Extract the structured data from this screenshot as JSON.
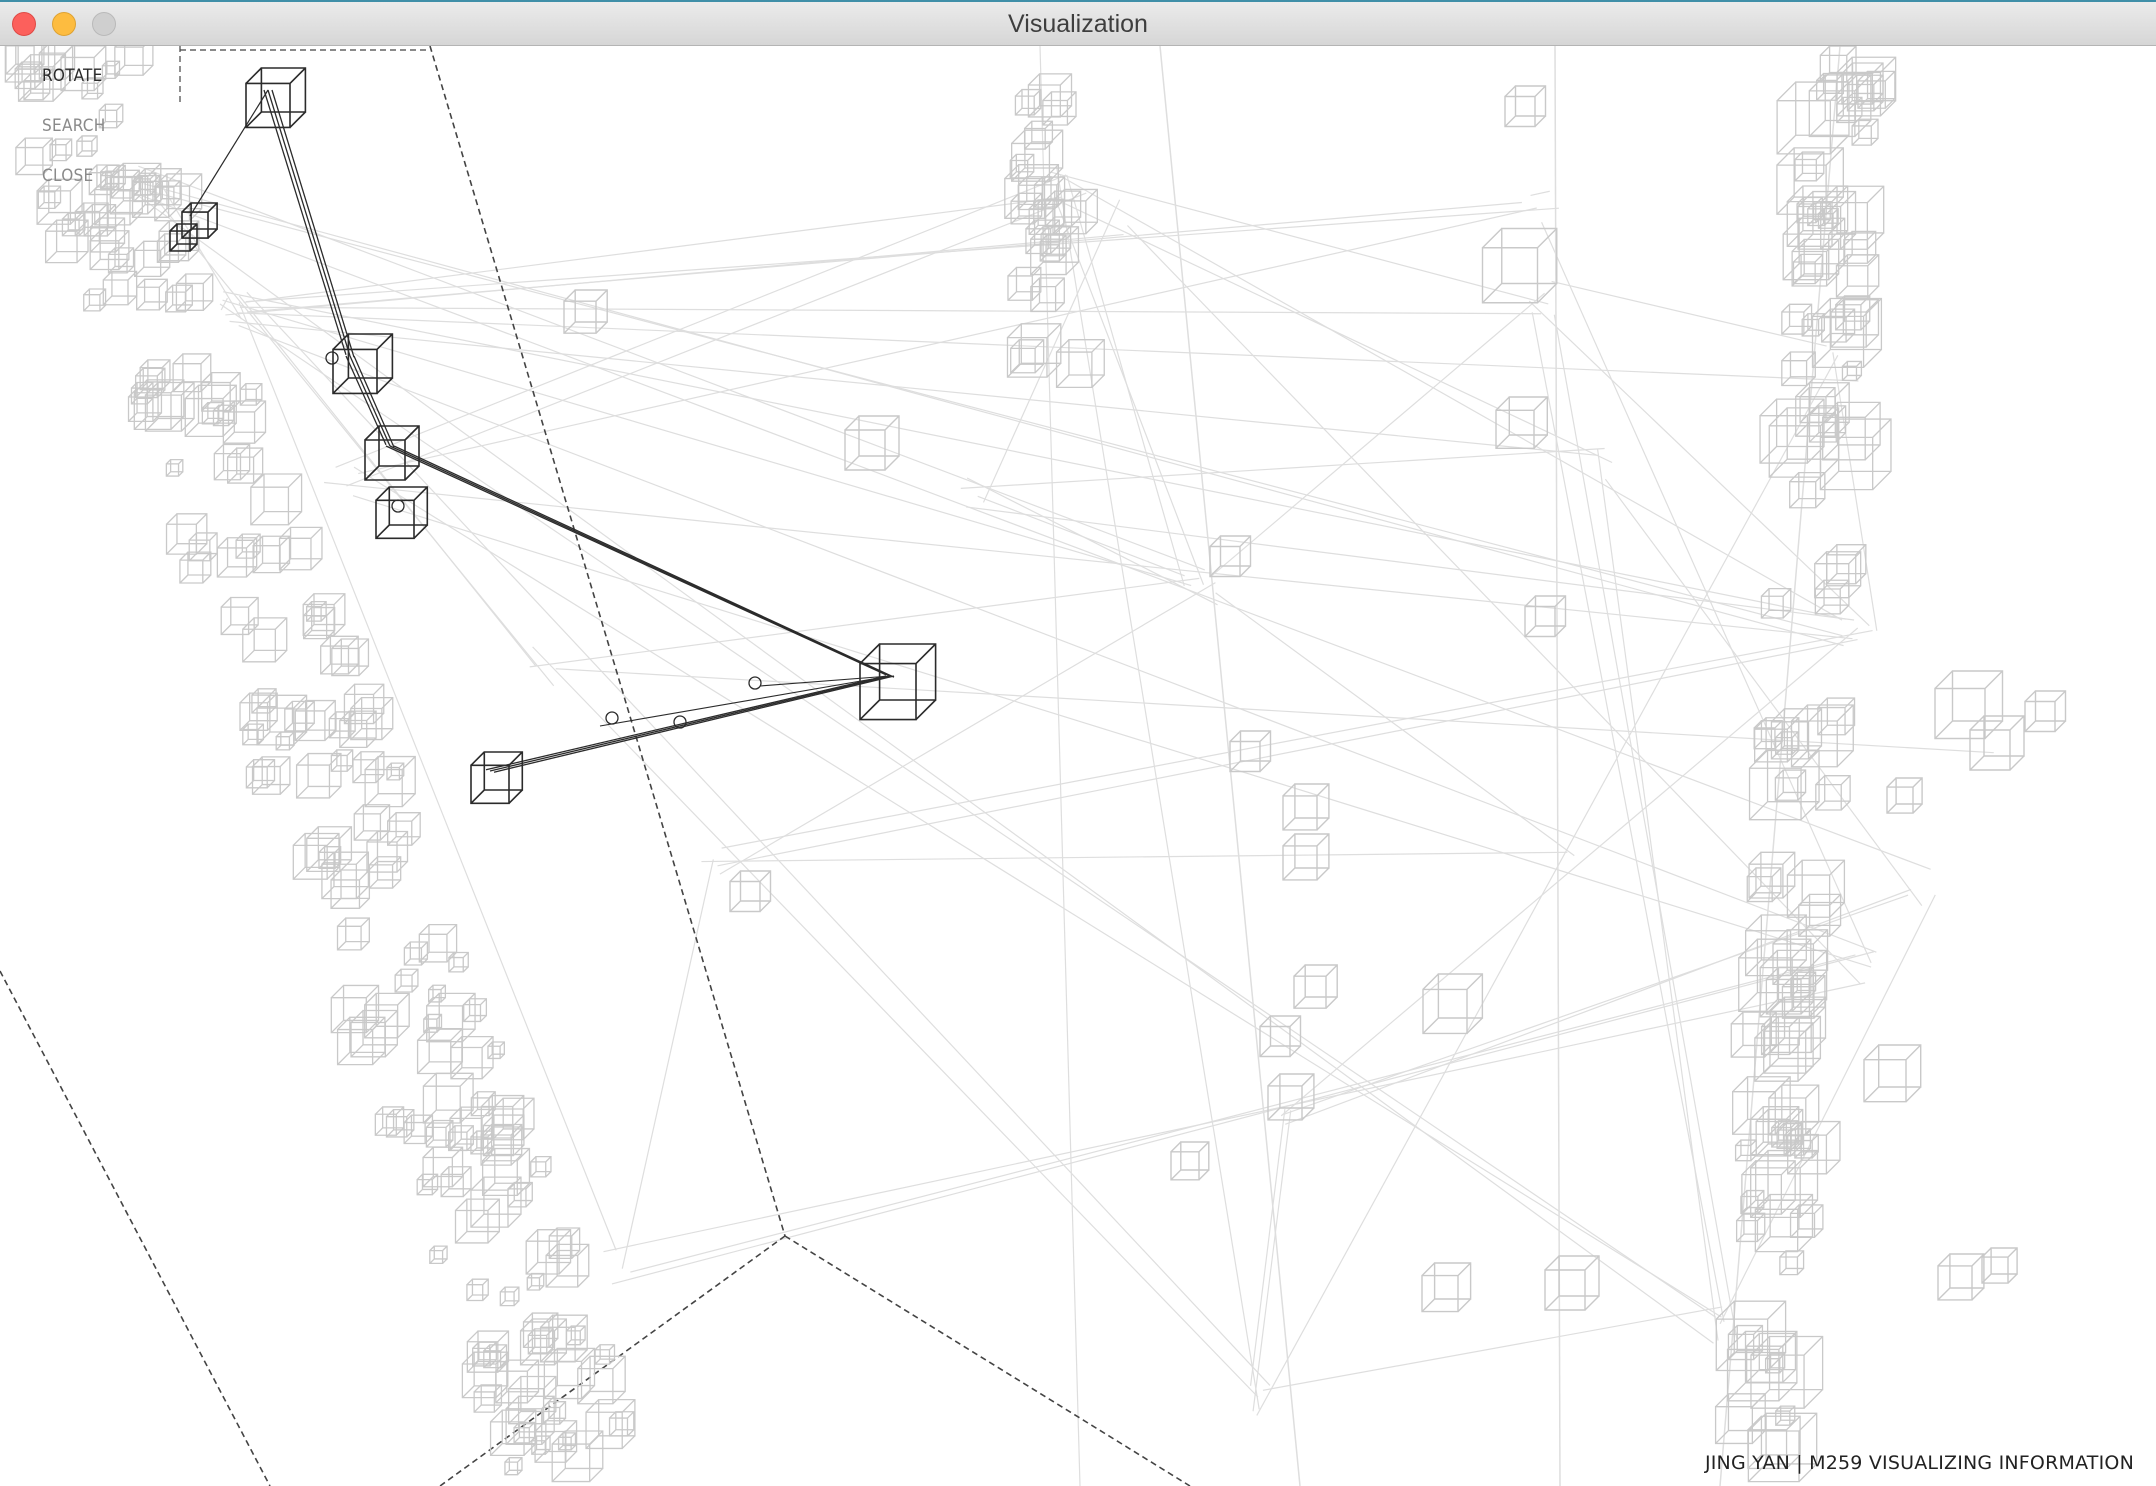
{
  "window": {
    "title": "Visualization",
    "accent_color": "#3f8fa8"
  },
  "controls": {
    "items": [
      "ROTATE",
      "SEARCH",
      "CLOSE"
    ]
  },
  "footer": {
    "credit": "JING YAN | M259 VISUALIZING INFORMATION"
  },
  "palette": {
    "background": "#ffffff",
    "highlight_stroke": "#2b2b2b",
    "context_stroke": "#c9c9c9",
    "faint_stroke": "#dedede"
  }
}
